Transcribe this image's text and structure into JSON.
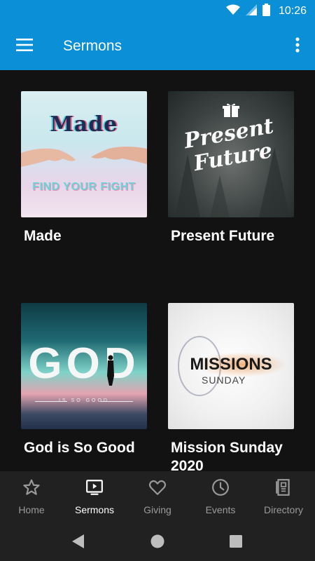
{
  "status_bar": {
    "time": "10:26"
  },
  "app_bar": {
    "title": "Sermons"
  },
  "sermons": [
    {
      "title": "Made",
      "art_title": "Made",
      "art_subtitle": "FIND YOUR FIGHT"
    },
    {
      "title": "Present Future",
      "art_title": "Present Future"
    },
    {
      "title": "God is So Good",
      "art_title": "GOD",
      "art_subtitle": "IS SO GOOD"
    },
    {
      "title": "Mission Sunday 2020",
      "art_title": "MISSIONS",
      "art_subtitle": "SUNDAY"
    }
  ],
  "bottom_nav": {
    "items": [
      {
        "label": "Home",
        "icon": "star-icon"
      },
      {
        "label": "Sermons",
        "icon": "video-icon"
      },
      {
        "label": "Giving",
        "icon": "heart-icon"
      },
      {
        "label": "Events",
        "icon": "clock-icon"
      },
      {
        "label": "Directory",
        "icon": "directory-icon"
      }
    ],
    "active": "Sermons"
  },
  "colors": {
    "primary": "#0b8fd6",
    "background": "#121212",
    "nav_background": "#212121",
    "inactive": "#9a9a9a",
    "active": "#ffffff"
  }
}
